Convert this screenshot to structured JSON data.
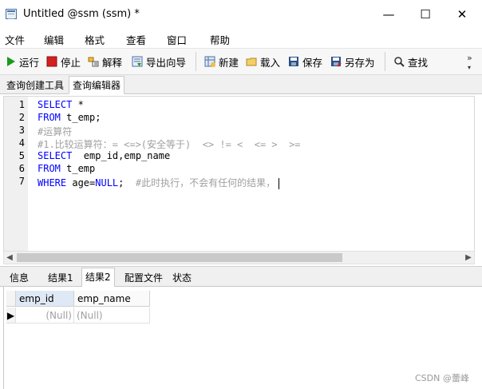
{
  "window": {
    "title": "Untitled @ssm (ssm) *",
    "minimize_glyph": "—",
    "maximize_glyph": "☐",
    "close_glyph": "✕"
  },
  "menu": [
    "文件",
    "编辑",
    "格式",
    "查看",
    "窗口",
    "帮助"
  ],
  "toolbar": {
    "run": "运行",
    "stop": "停止",
    "explain": "解释",
    "export_wizard": "导出向导",
    "new": "新建",
    "load": "载入",
    "save": "保存",
    "save_as": "另存为",
    "find": "查找",
    "more_glyph": "»"
  },
  "top_tabs": [
    "查询创建工具",
    "查询编辑器"
  ],
  "active_top_tab": "查询编辑器",
  "editor": {
    "lines": [
      {
        "no": "1",
        "parts": [
          {
            "t": "SELECT",
            "c": "kw"
          },
          {
            "t": " *",
            "c": ""
          }
        ]
      },
      {
        "no": "2",
        "parts": [
          {
            "t": "FROM",
            "c": "kw"
          },
          {
            "t": " t_emp;",
            "c": ""
          }
        ]
      },
      {
        "no": "3",
        "parts": [
          {
            "t": "#运算符",
            "c": "cm"
          }
        ]
      },
      {
        "no": "4",
        "parts": [
          {
            "t": "#1.比较运算符：= <=>(安全等于)  <> != <  <= >  >=",
            "c": "cm"
          }
        ]
      },
      {
        "no": "5",
        "parts": [
          {
            "t": "SELECT",
            "c": "kw"
          },
          {
            "t": "  emp_id,emp_name",
            "c": ""
          }
        ]
      },
      {
        "no": "6",
        "parts": [
          {
            "t": "FROM",
            "c": "kw"
          },
          {
            "t": " t_emp",
            "c": ""
          }
        ]
      },
      {
        "no": "7",
        "parts": [
          {
            "t": "WHERE",
            "c": "kw"
          },
          {
            "t": " age=",
            "c": ""
          },
          {
            "t": "NULL",
            "c": "kw"
          },
          {
            "t": ";  ",
            "c": ""
          },
          {
            "t": "#此时执行，不会有任何的结果，",
            "c": "cm"
          }
        ]
      }
    ]
  },
  "bottom_tabs": [
    "信息",
    "结果1",
    "结果2",
    "配置文件",
    "状态"
  ],
  "active_bottom_tab": "结果2",
  "result_grid": {
    "columns": [
      "emp_id",
      "emp_name"
    ],
    "rows": [
      [
        "(Null)",
        "(Null)"
      ]
    ]
  },
  "watermark": "CSDN @蕾峰",
  "colors": {
    "keyword": "#0000ff",
    "comment": "#a0a0a0",
    "stop_red": "#d42020",
    "run_green": "#1a9a1a"
  }
}
